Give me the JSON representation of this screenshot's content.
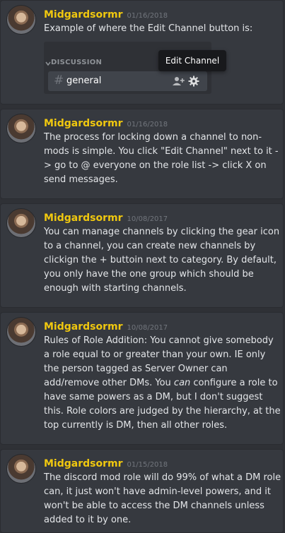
{
  "messages": [
    {
      "author": "Midgardsormr",
      "timestamp": "01/16/2018",
      "text": "Example of where the Edit Channel button is:",
      "embed": {
        "category": "DISCUSSION",
        "channel_hash": "#",
        "channel_name": "general",
        "tooltip": "Edit Channel"
      }
    },
    {
      "author": "Midgardsormr",
      "timestamp": "01/16/2018",
      "text": "The process for locking down a channel to non-mods is simple. You click \"Edit Channel\" next to it -> go to @ everyone on the role list -> click X on send messages."
    },
    {
      "author": "Midgardsormr",
      "timestamp": "10/08/2017",
      "text": "You can manage channels by clicking the gear icon to a channel, you can create new channels by clickign the + buttoin next to category. By default, you only have the one group which should be enough with starting channels."
    },
    {
      "author": "Midgardsormr",
      "timestamp": "10/08/2017",
      "text_part1": "Rules of Role Addition: You cannot give somebody a role equal to or greater than your own. IE only the person tagged as Server Owner can add/remove other DMs. You ",
      "text_emphasis": "can",
      "text_part2": " configure a role to have same powers as a DM, but I don't suggest this. Role colors are judged by the hierarchy, at the top currently is DM, then all other roles."
    },
    {
      "author": "Midgardsormr",
      "timestamp": "01/15/2018",
      "text": "The discord mod role will do 99% of what a DM role can, it just won't have admin-level powers, and it won't be able to access the DM channels unless added to it by one."
    }
  ],
  "colors": {
    "author": "#f0c80f",
    "background": "#2f3136",
    "message_bg": "#36393f",
    "timestamp": "#72767d"
  },
  "icons": [
    "add-user-icon",
    "gear-icon",
    "chevron-down-icon"
  ]
}
